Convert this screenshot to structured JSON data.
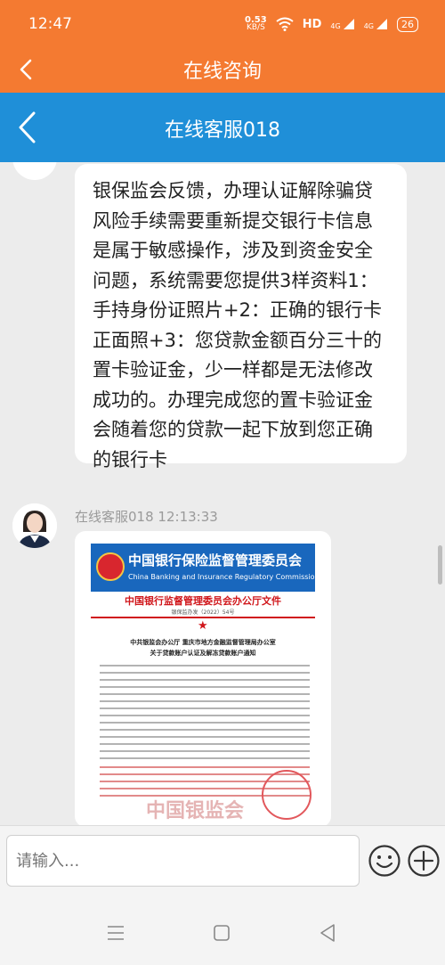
{
  "status_bar": {
    "time": "12:47",
    "speed_value": "0.53",
    "speed_unit": "KB/S",
    "hd": "HD",
    "net1": "4G",
    "net2": "4G",
    "battery": "26"
  },
  "outer_header": {
    "title": "在线咨询"
  },
  "inner_header": {
    "title": "在线客服018"
  },
  "messages": [
    {
      "text": "银保监会反馈，办理认证解除骗贷风险手续需要重新提交银行卡信息是属于敏感操作，涉及到资金安全问题，系统需要您提供3样资料1：手持身份证照片+2：正确的银行卡正面照+3：您贷款金额百分三十的置卡验证金，少一样都是无法修改成功的。办理完成您的置卡验证金会随着您的贷款一起下放到您正确的银行卡"
    },
    {
      "sender": "在线客服018",
      "time": "12:13:33",
      "doc": {
        "banner_cn": "中国银行保险监督管理委员会",
        "banner_en": "China Banking and Insurance Regulatory Commission",
        "heading": "中国银行监督管理委员会办公厅文件",
        "doc_number": "银保监办发（2022）54号",
        "subheading": "中共银监会办公厅 重庆市地方金融监督管理局办公室",
        "subheading2": "关于贷款账户认证及解冻贷款账户通知",
        "watermark": "中国银监会"
      }
    }
  ],
  "input": {
    "placeholder": "请输入..."
  },
  "colors": {
    "orange_header": "#f47a31",
    "blue_header": "#1f8fd8",
    "background": "#ececec"
  },
  "icons": {
    "outer_back": "chevron-left-icon",
    "inner_back": "chevron-left-icon",
    "emoji": "smiley-icon",
    "plus": "plus-circle-icon",
    "nav_menu": "menu-icon",
    "nav_home": "square-icon",
    "nav_back": "triangle-back-icon"
  }
}
